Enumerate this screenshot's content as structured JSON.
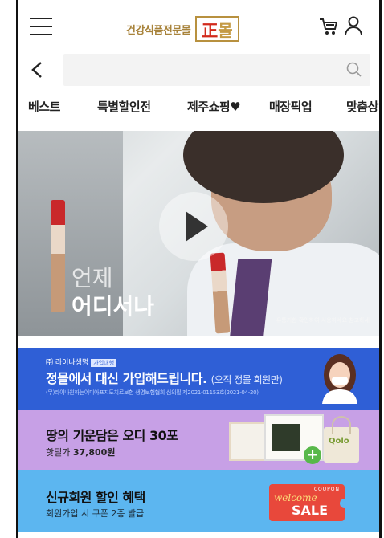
{
  "header": {
    "logo_sub": "건강식품전문몰",
    "logo_main_left": "正",
    "logo_main_right": "몰"
  },
  "search": {
    "value": "",
    "placeholder": ""
  },
  "nav": {
    "items": [
      "베스트",
      "특별할인전",
      "제주쇼핑♥",
      "매장픽업",
      "맞춤상"
    ]
  },
  "video": {
    "line1": "언제",
    "line2": "어디서나",
    "caption": "유통기한 확인하여 사용하세요 참고하세"
  },
  "banners": {
    "join": {
      "brand": "㈜ 라이나생명",
      "brand_tag": "가입대행",
      "title": "정몰에서 대신 가입해드립니다.",
      "title_note": "(오직 정몰 회원만)",
      "sub": "(무)라이나원하는어디아프지도치료보험 생명보험협회 심의필 제2021-01153호(2021-04-20)"
    },
    "product": {
      "title": "땅의 기운담은 오디 30포",
      "price_label": "핫딜가",
      "price": "37,800원",
      "bag_text": "Qolo"
    },
    "coupon": {
      "title": "신규회원 할인 혜택",
      "sub": "회원가입 시 쿠폰 2종 발급",
      "coupon_top": "COUPON",
      "coupon_welcome": "welcome",
      "coupon_sale": "SALE"
    }
  },
  "colors": {
    "join_bg": "#2f5fd6",
    "product_bg": "#c7a0e6",
    "coupon_bg": "#5cb6f0",
    "logo_gold": "#b8913f",
    "logo_red": "#d22a1c"
  }
}
